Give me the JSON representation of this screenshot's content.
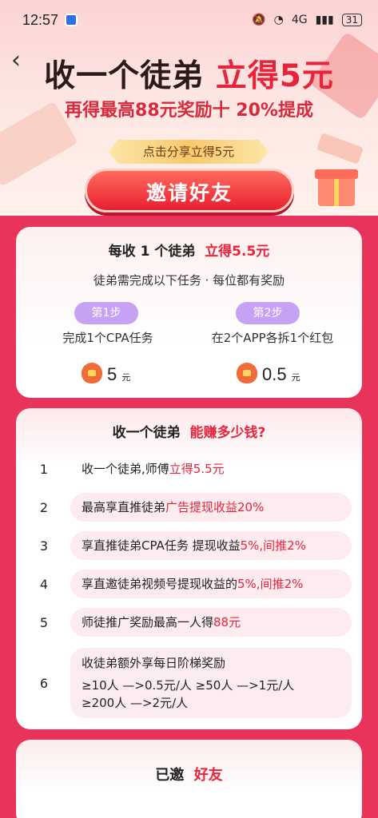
{
  "status_bar": {
    "time": "12:57",
    "network": "4G",
    "battery": "31"
  },
  "header": {
    "title_part1": "收一个徒弟",
    "title_part2": "立得5元",
    "subtitle": "再得最高88元奖励十 20%提成",
    "share_tag": "点击分享立得5元",
    "invite_button": "邀请好友"
  },
  "rules_card": {
    "head_part1": "每收 1 个徒弟",
    "head_part2": "立得5.5元",
    "subtitle": "徒弟需完成以下任务 · 每位都有奖励",
    "steps": [
      {
        "label": "第1步",
        "task": "完成1个CPA任务",
        "reward": "5",
        "unit": "元"
      },
      {
        "label": "第2步",
        "task": "在2个APP各拆1个红包",
        "reward": "0.5",
        "unit": "元"
      }
    ]
  },
  "earn_card": {
    "head_part1": "收一个徒弟",
    "head_part2": "能赚多少钱?",
    "items": [
      {
        "index": "1",
        "text": "收一个徒弟,师傅",
        "highlight": "立得5.5元"
      },
      {
        "index": "2",
        "text": "最高享直推徒弟",
        "highlight": "广告提现收益20%"
      },
      {
        "index": "3",
        "text": "享直推徒弟CPA任务 提现收益",
        "highlight": "5%,间推2%"
      },
      {
        "index": "4",
        "text": "享直邀徒弟视频号提现收益的",
        "highlight": "5%,间推2%"
      },
      {
        "index": "5",
        "text": "师徒推广奖励最高一人得",
        "highlight": "88元"
      },
      {
        "index": "6",
        "line1": "收徒弟额外享每日阶梯奖励",
        "line2": "≥10人 —>0.5元/人    ≥50人 —>1元/人",
        "line3": "≥200人 —>2元/人"
      }
    ]
  },
  "invited_card": {
    "head_part1": "已邀",
    "head_part2": "好友"
  },
  "colors": {
    "accent": "#e8243c",
    "background": "#e8345a",
    "step_badge": "#c6a2f4"
  }
}
